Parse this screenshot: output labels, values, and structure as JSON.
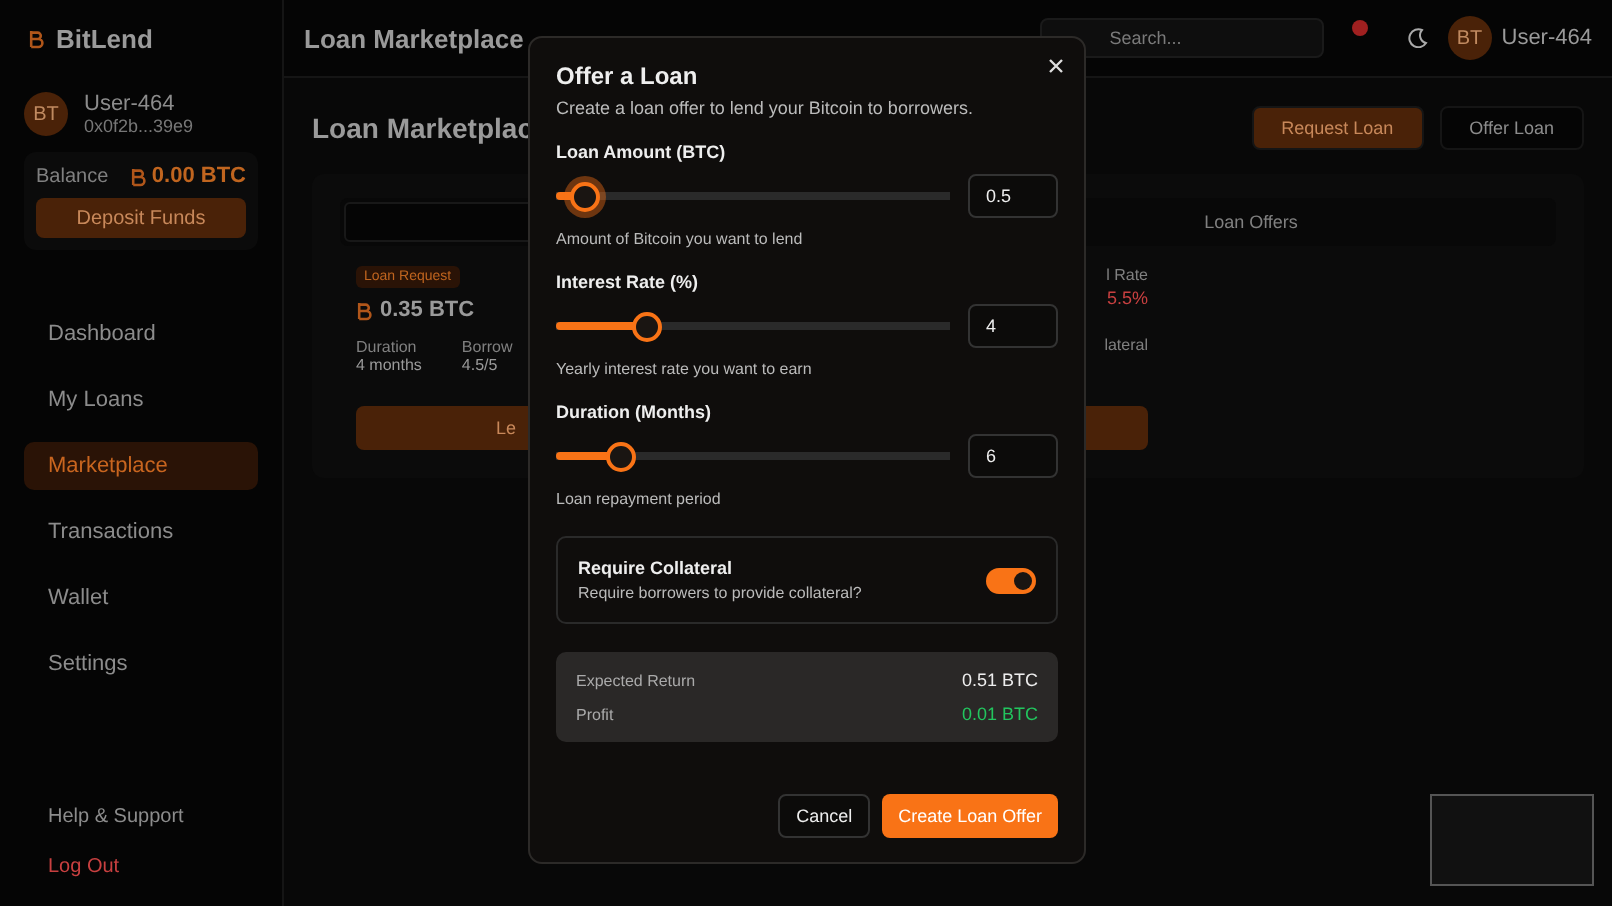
{
  "brand": {
    "name": "BitLend"
  },
  "sidebar": {
    "user": {
      "initials": "BT",
      "name": "User-464",
      "address": "0x0f2b...39e9"
    },
    "balance": {
      "label": "Balance",
      "amount": "0.00 BTC"
    },
    "deposit_button": "Deposit Funds",
    "nav": [
      {
        "label": "Dashboard",
        "selected": false
      },
      {
        "label": "My Loans",
        "selected": false
      },
      {
        "label": "Marketplace",
        "selected": true
      },
      {
        "label": "Transactions",
        "selected": false
      },
      {
        "label": "Wallet",
        "selected": false
      },
      {
        "label": "Settings",
        "selected": false
      }
    ],
    "footer": [
      {
        "label": "Help & Support",
        "kind": "link"
      },
      {
        "label": "Log Out",
        "kind": "danger"
      }
    ]
  },
  "header": {
    "title": "Loan Marketplace",
    "search": {
      "placeholder": "Search..."
    },
    "notifications": {
      "unread": true
    },
    "user": {
      "initials": "BT",
      "name": "User-464"
    }
  },
  "main": {
    "title": "Loan Marketplac",
    "actions": [
      {
        "label": "Request Loan",
        "kind": "primary"
      },
      {
        "label": "Offer Loan",
        "kind": "secondary"
      }
    ],
    "tabs": [
      {
        "selected": true
      },
      {
        "label": "Loan Offers",
        "selected": false
      }
    ],
    "card": {
      "badge": "Loan Request",
      "amount": "0.35 BTC",
      "fields": [
        {
          "label": "Duration",
          "value": "4 months"
        },
        {
          "label": "Borrow",
          "value": "4.5/5"
        }
      ],
      "right_fragments": [
        {
          "text": "l Rate",
          "kind": "label"
        },
        {
          "text": "5.5%",
          "kind": "rate"
        },
        {
          "text": "lateral",
          "kind": "label"
        }
      ],
      "button": "Le"
    }
  },
  "modal": {
    "title": "Offer a Loan",
    "subtitle": "Create a loan offer to lend your Bitcoin to borrowers.",
    "sliders": [
      {
        "label": "Loan Amount (BTC)",
        "level": 0.07,
        "value": "0.5",
        "hint": "Amount of Bitcoin you want to lend",
        "focused": true
      },
      {
        "label": "Interest Rate (%)",
        "level": 0.23,
        "value": "4",
        "hint": "Yearly interest rate you want to earn",
        "focused": false
      },
      {
        "label": "Duration (Months)",
        "level": 0.16,
        "value": "6",
        "hint": "Loan repayment period",
        "focused": false
      }
    ],
    "collateral": {
      "title": "Require Collateral",
      "description": "Require borrowers to provide collateral?",
      "on": true
    },
    "summary": [
      {
        "label": "Expected Return",
        "value": "0.51 BTC",
        "kind": "normal"
      },
      {
        "label": "Profit",
        "value": "0.01 BTC",
        "kind": "positive"
      }
    ],
    "buttons": [
      {
        "label": "Cancel",
        "kind": "secondary"
      },
      {
        "label": "Create Loan Offer",
        "kind": "primary"
      }
    ]
  }
}
